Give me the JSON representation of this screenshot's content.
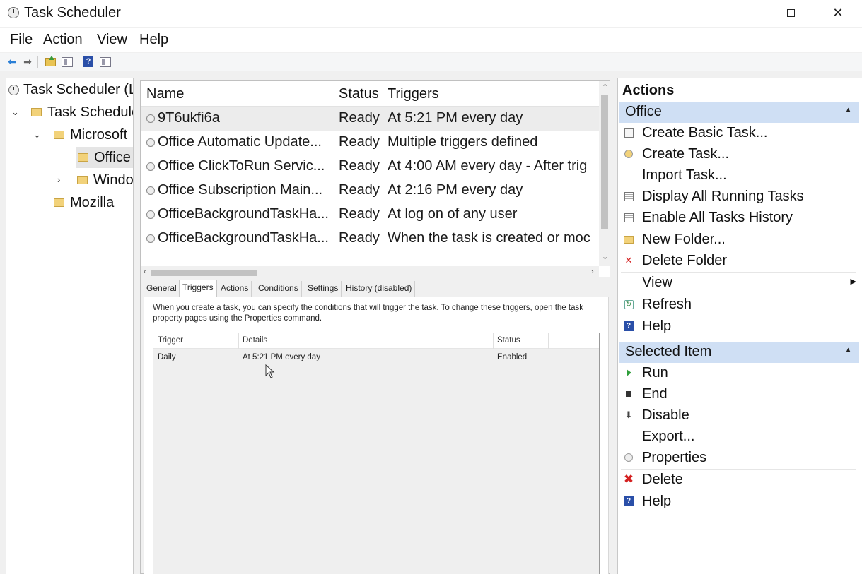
{
  "window": {
    "title": "Task Scheduler"
  },
  "menu": [
    "File",
    "Action",
    "View",
    "Help"
  ],
  "tree": {
    "root": "Task Scheduler (L",
    "library": "Task Schedule",
    "microsoft": "Microsoft",
    "office": "Office",
    "windows": "Windo",
    "mozilla": "Mozilla"
  },
  "tasks": {
    "columns": [
      "Name",
      "Status",
      "Triggers"
    ],
    "rows": [
      {
        "name": "9T6ukfi6a",
        "status": "Ready",
        "triggers": "At 5:21 PM every day"
      },
      {
        "name": "Office Automatic Update...",
        "status": "Ready",
        "triggers": "Multiple triggers defined"
      },
      {
        "name": "Office ClickToRun Servic...",
        "status": "Ready",
        "triggers": "At 4:00 AM every day - After trig"
      },
      {
        "name": "Office Subscription Main...",
        "status": "Ready",
        "triggers": "At 2:16 PM every day"
      },
      {
        "name": "OfficeBackgroundTaskHa...",
        "status": "Ready",
        "triggers": "At log on of any user"
      },
      {
        "name": "OfficeBackgroundTaskHa...",
        "status": "Ready",
        "triggers": "When the task is created or moc"
      }
    ]
  },
  "detail": {
    "tabs": [
      "General",
      "Triggers",
      "Actions",
      "Conditions",
      "Settings",
      "History (disabled)"
    ],
    "active_tab": "Triggers",
    "description": "When you create a task, you can specify the conditions that will trigger the task.  To change these triggers, open the task property pages using the Properties command.",
    "trigger_columns": [
      "Trigger",
      "Details",
      "Status"
    ],
    "trigger_rows": [
      {
        "trigger": "Daily",
        "details": "At 5:21 PM every day",
        "status": "Enabled"
      }
    ]
  },
  "actions": {
    "title": "Actions",
    "office_section": "Office",
    "office_items": [
      "Create Basic Task...",
      "Create Task...",
      "Import Task...",
      "Display All Running Tasks",
      "Enable All Tasks History",
      "New Folder...",
      "Delete Folder",
      "View",
      "Refresh",
      "Help"
    ],
    "selected_section": "Selected Item",
    "selected_items": [
      "Run",
      "End",
      "Disable",
      "Export...",
      "Properties",
      "Delete",
      "Help"
    ]
  }
}
